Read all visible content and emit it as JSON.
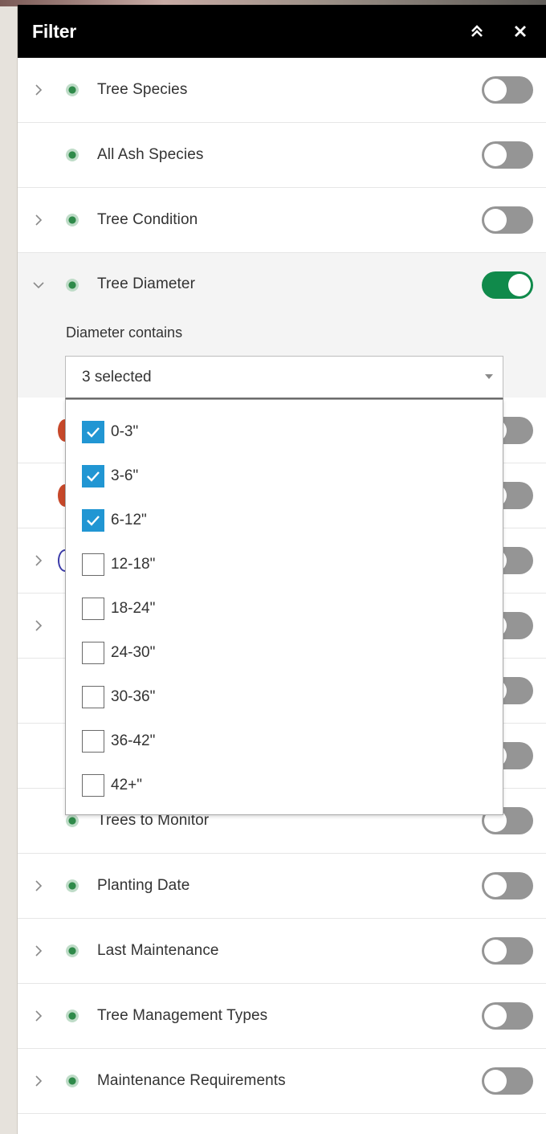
{
  "header": {
    "title": "Filter",
    "collapse_icon": "chevron-double-up-icon",
    "close_icon": "close-icon"
  },
  "colors": {
    "header_bg": "#000000",
    "toggle_on": "#108a4b",
    "toggle_off": "#959595",
    "checkbox_checked": "#2196d3",
    "layer_dot": "#2f8a4a"
  },
  "filters": [
    {
      "label": "Tree Species",
      "has_chevron": true,
      "enabled": false
    },
    {
      "label": "All Ash Species",
      "has_chevron": false,
      "enabled": false
    },
    {
      "label": "Tree Condition",
      "has_chevron": true,
      "enabled": false
    },
    {
      "label": "Tree Diameter",
      "has_chevron": true,
      "expanded": true,
      "enabled": true
    }
  ],
  "diameter_clause": {
    "label": "Diameter contains",
    "selected_text": "3 selected",
    "options": [
      {
        "label": "0-3\"",
        "checked": true
      },
      {
        "label": "3-6\"",
        "checked": true
      },
      {
        "label": "6-12\"",
        "checked": true
      },
      {
        "label": "12-18\"",
        "checked": false
      },
      {
        "label": "18-24\"",
        "checked": false
      },
      {
        "label": "24-30\"",
        "checked": false
      },
      {
        "label": "30-36\"",
        "checked": false
      },
      {
        "label": "36-42\"",
        "checked": false
      },
      {
        "label": "42+\"",
        "checked": false
      }
    ]
  },
  "filters_below": [
    {
      "label": "Trees to Monitor",
      "has_chevron": false,
      "enabled": false
    },
    {
      "label": "Planting Date",
      "has_chevron": true,
      "enabled": false
    },
    {
      "label": "Last Maintenance",
      "has_chevron": true,
      "enabled": false
    },
    {
      "label": "Tree Management Types",
      "has_chevron": true,
      "enabled": false
    },
    {
      "label": "Maintenance Requirements",
      "has_chevron": true,
      "enabled": false
    }
  ]
}
